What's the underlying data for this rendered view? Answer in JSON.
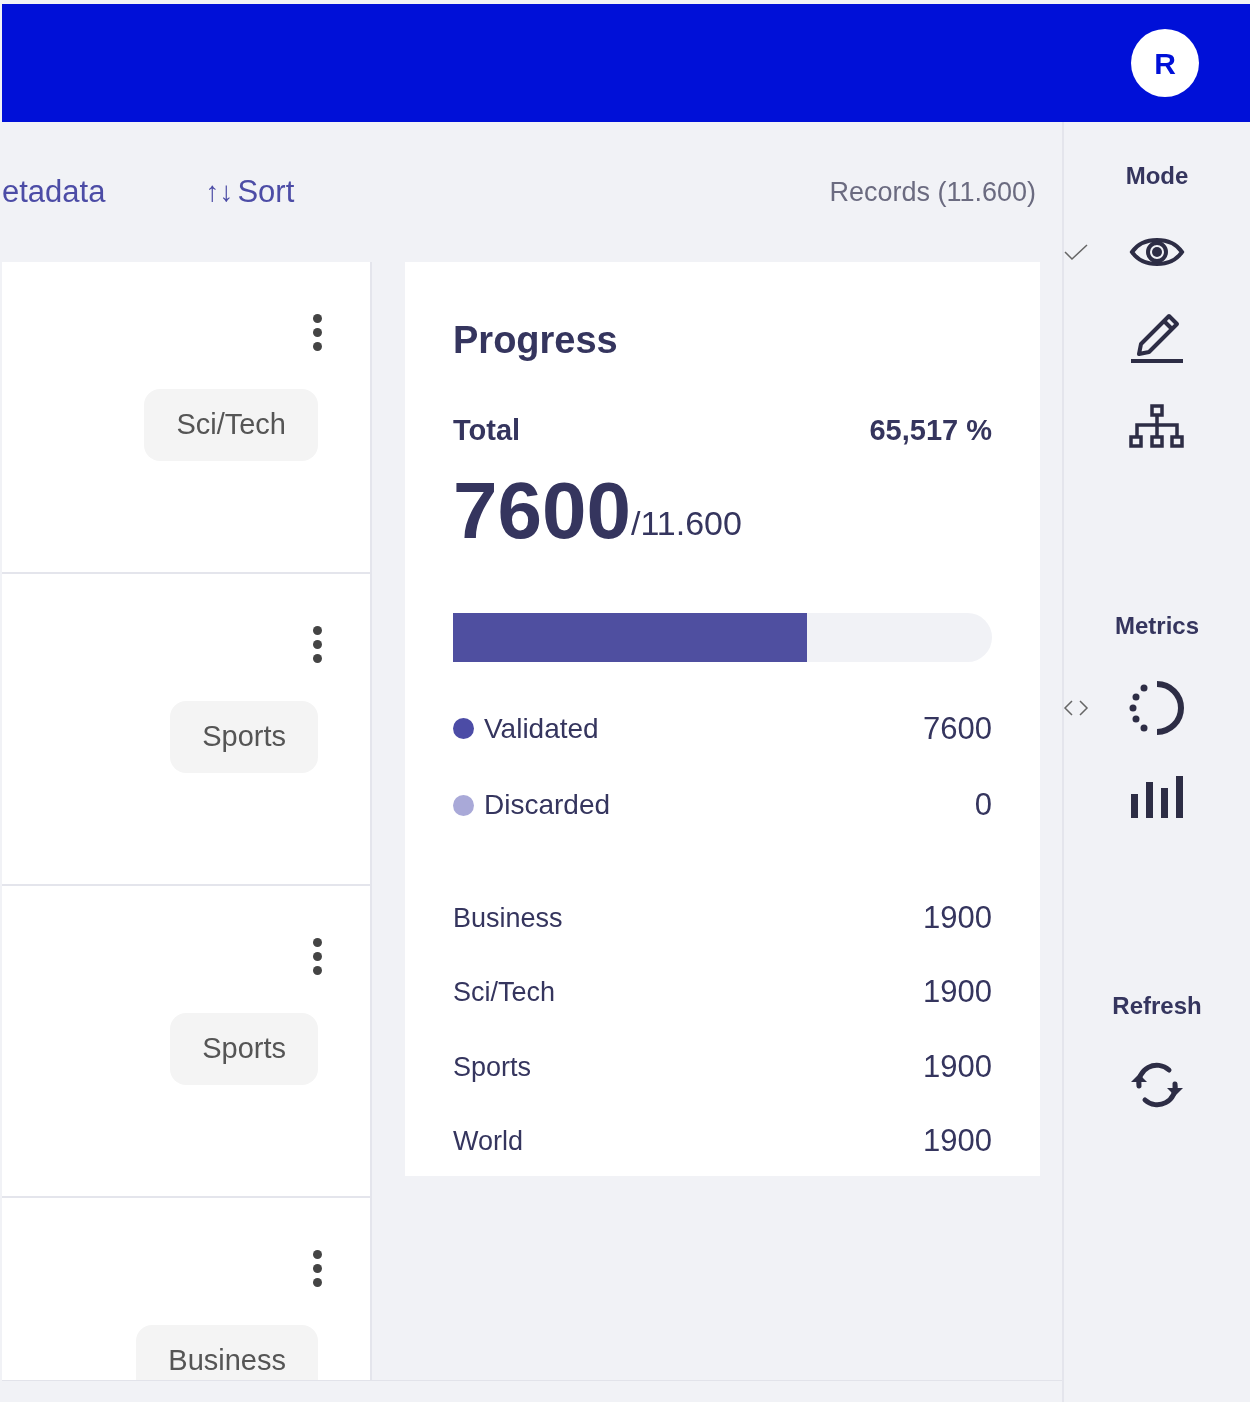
{
  "header": {
    "avatar": "R"
  },
  "toolbar": {
    "metadata_link": "etadata",
    "sort_button": {
      "icon": "↑↓",
      "label": "Sort"
    },
    "records": "Records (11.600)"
  },
  "records": [
    {
      "tag": "Sci/Tech"
    },
    {
      "tag": "Sports"
    },
    {
      "tag": "Sports"
    },
    {
      "tag": "Business"
    }
  ],
  "progress": {
    "title": "Progress",
    "total_label": "Total",
    "total_percent": "65,517 %",
    "count": "7600",
    "of": "/11.600",
    "level": 0.656,
    "legend": [
      {
        "label": "Validated",
        "value": "7600",
        "color": "#4c4ca6"
      },
      {
        "label": "Discarded",
        "value": "0",
        "color": "#a9a9d8"
      }
    ],
    "categories": [
      {
        "label": "Business",
        "value": "1900"
      },
      {
        "label": "Sci/Tech",
        "value": "1900"
      },
      {
        "label": "Sports",
        "value": "1900"
      },
      {
        "label": "World",
        "value": "1900"
      }
    ]
  },
  "sidebar": {
    "mode": {
      "title": "Mode",
      "items": [
        {
          "kind": "view",
          "selected": true
        },
        {
          "kind": "edit",
          "selected": false
        },
        {
          "kind": "tree",
          "selected": false
        }
      ]
    },
    "metrics": {
      "title": "Metrics",
      "items": [
        {
          "kind": "progress",
          "selected": true
        },
        {
          "kind": "bars",
          "selected": false
        }
      ]
    },
    "refresh": {
      "title": "Refresh"
    }
  }
}
